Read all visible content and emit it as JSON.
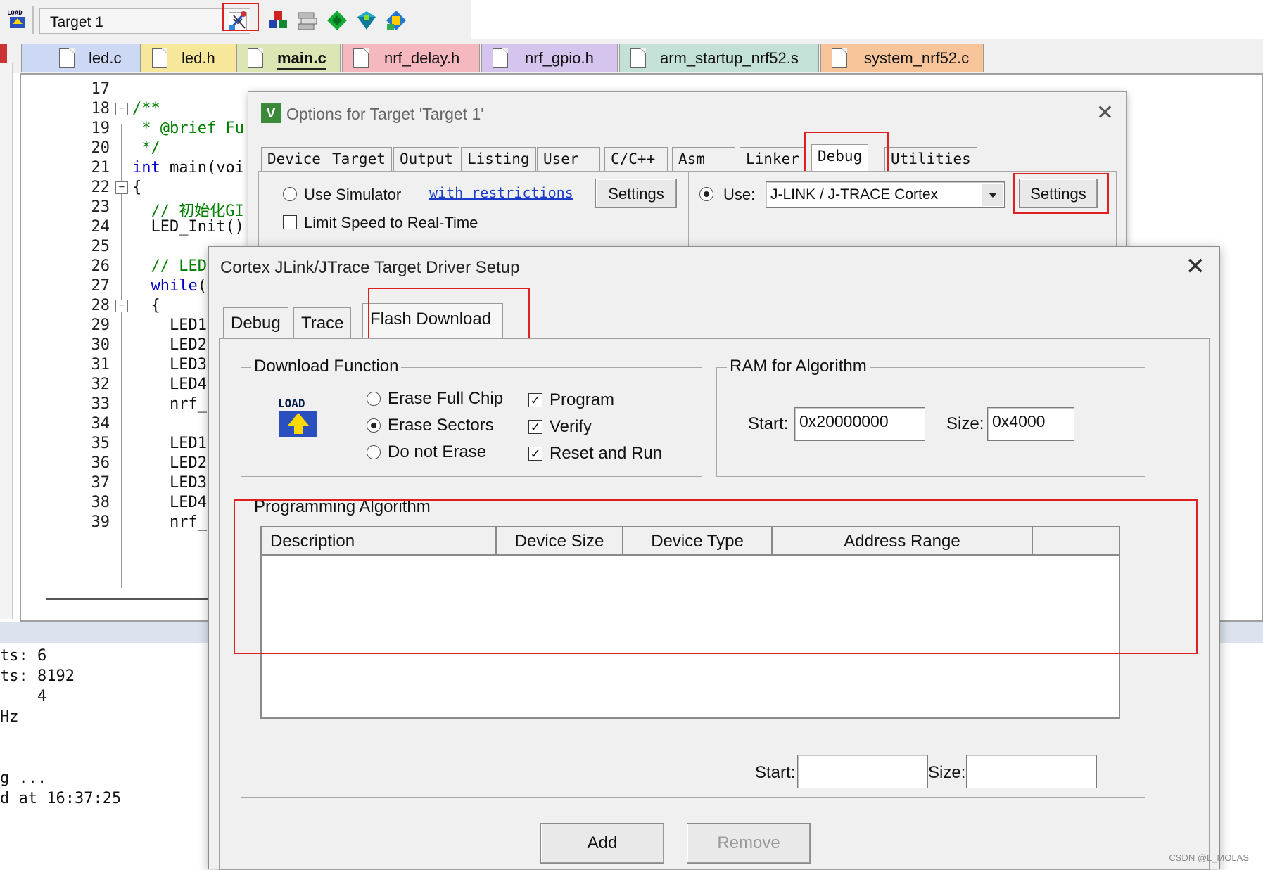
{
  "toolbar": {
    "target_select": "Target 1",
    "icons": [
      "load-icon",
      "options-for-target-icon",
      "manage-components-icon",
      "manage-runtime-icon",
      "select-packs-icon",
      "pack-installer-icon",
      "pack-debug-icon"
    ]
  },
  "file_tabs": [
    {
      "label": "led.c",
      "color": "#cdd8f5"
    },
    {
      "label": "led.h",
      "color": "#f7e79a"
    },
    {
      "label": "main.c",
      "color": "#dbe6b4"
    },
    {
      "label": "nrf_delay.h",
      "color": "#f5b8be"
    },
    {
      "label": "nrf_gpio.h",
      "color": "#d4c4ee"
    },
    {
      "label": "arm_startup_nrf52.s",
      "color": "#c4e1d8"
    },
    {
      "label": "system_nrf52.c",
      "color": "#f8c49a"
    }
  ],
  "editor": {
    "line_numbers": [
      "17",
      "18",
      "19",
      "20",
      "21",
      "22",
      "23",
      "24",
      "25",
      "26",
      "27",
      "28",
      "29",
      "30",
      "31",
      "32",
      "33",
      "34",
      "35",
      "36",
      "37",
      "38",
      "39"
    ],
    "lines": [
      "",
      "/**",
      " * @brief Fu",
      " */",
      "int main(voi",
      "{",
      "  // 初始化GI",
      "  LED_Init()",
      "",
      "  // LED",
      "  while(",
      "  {",
      "    LED1",
      "    LED2",
      "    LED3",
      "    LED4",
      "    nrf_",
      "",
      "    LED1",
      "    LED2",
      "    LED3",
      "    LED4",
      "    nrf_"
    ]
  },
  "output": {
    "lines": [
      "ts: 6",
      "ts: 8192",
      "    4",
      "Hz",
      "",
      "",
      "g ...",
      "d at 16:37:25"
    ]
  },
  "options_dialog": {
    "title": "Options for Target 'Target 1'",
    "tabs": [
      "Device",
      "Target",
      "Output",
      "Listing",
      "User",
      "C/C++",
      "Asm",
      "Linker",
      "Debug",
      "Utilities"
    ],
    "active_tab": "Debug",
    "use_simulator": "Use Simulator",
    "with_restrictions": "with restrictions",
    "settings_left": "Settings",
    "limit_speed": "Limit Speed to Real-Time",
    "use_label": "Use:",
    "debugger": "J-LINK / J-TRACE Cortex",
    "settings_right": "Settings"
  },
  "jlink_dialog": {
    "title": "Cortex JLink/JTrace Target Driver Setup",
    "tabs": [
      "Debug",
      "Trace",
      "Flash Download"
    ],
    "active_tab": "Flash Download",
    "download_function": {
      "title": "Download Function",
      "erase_full_chip": "Erase Full Chip",
      "erase_sectors": "Erase Sectors",
      "do_not_erase": "Do not Erase",
      "program": "Program",
      "verify": "Verify",
      "reset_and_run": "Reset and Run",
      "selected_erase": "Erase Sectors",
      "program_checked": true,
      "verify_checked": true,
      "reset_checked": true,
      "logo_text": "LOAD"
    },
    "ram": {
      "title": "RAM for Algorithm",
      "start_label": "Start:",
      "start_value": "0x20000000",
      "size_label": "Size:",
      "size_value": "0x4000"
    },
    "algorithm": {
      "title": "Programming Algorithm",
      "columns": [
        "Description",
        "Device Size",
        "Device Type",
        "Address Range"
      ],
      "rows": [],
      "start_label": "Start:",
      "start_value": "",
      "size_label": "Size:",
      "size_value": ""
    },
    "add_button": "Add",
    "remove_button": "Remove"
  },
  "highlight_color": "#e02020",
  "watermark": "CSDN @L_MOLAS"
}
